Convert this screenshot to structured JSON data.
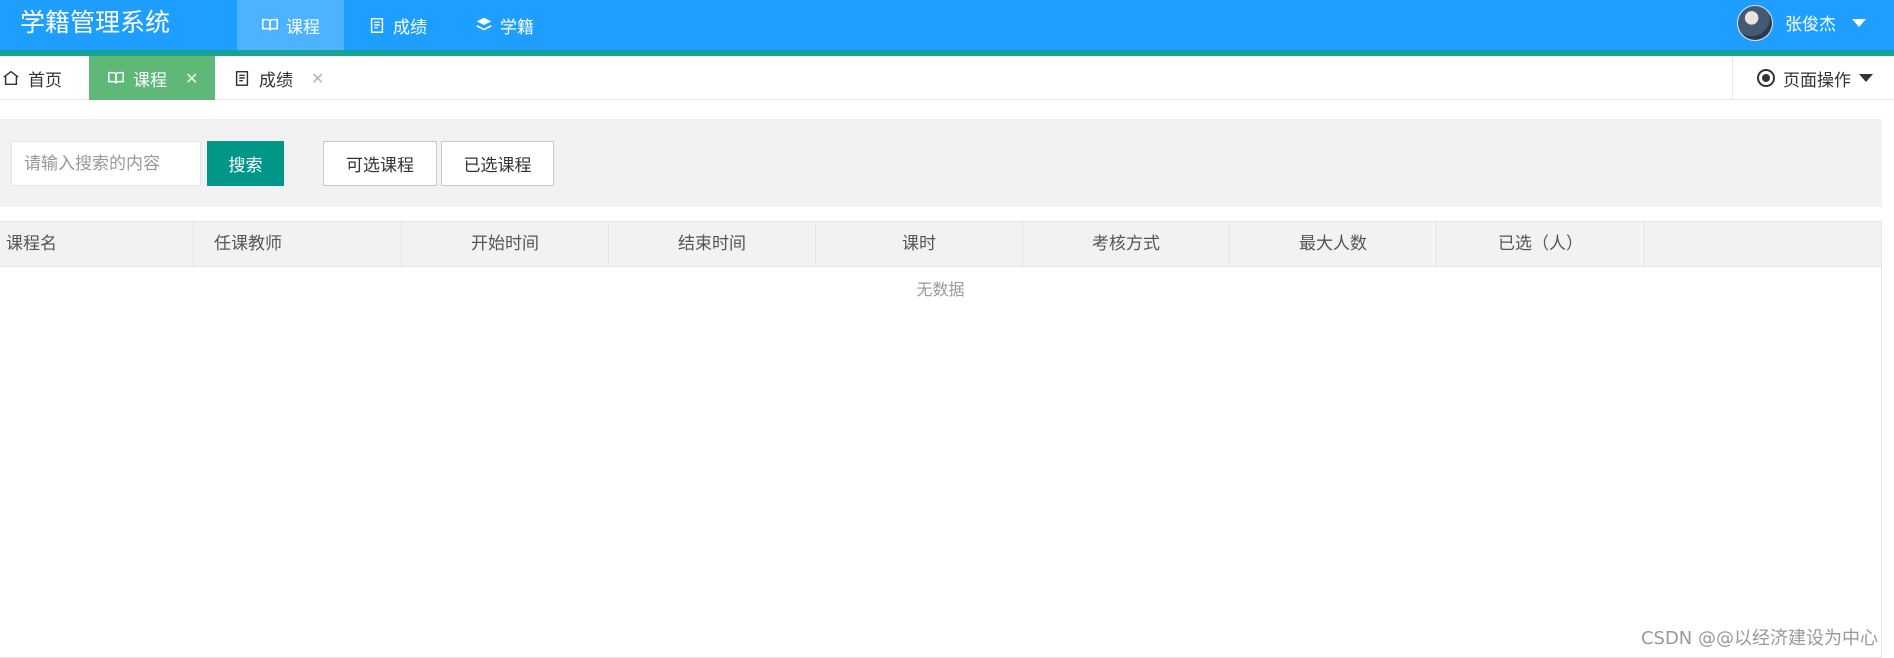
{
  "header": {
    "title": "学籍管理系统",
    "nav": [
      {
        "label": "课程",
        "icon": "book-icon",
        "active": true
      },
      {
        "label": "成绩",
        "icon": "clipboard-icon",
        "active": false
      },
      {
        "label": "学籍",
        "icon": "layers-icon",
        "active": false
      }
    ],
    "user_name": "张俊杰"
  },
  "tabs": {
    "home": "首页",
    "course": "课程",
    "score": "成绩",
    "close_glyph": "✕",
    "page_ops": "页面操作"
  },
  "toolbar": {
    "search_placeholder": "请输入搜索的内容",
    "search_button": "搜索",
    "available_button": "可选课程",
    "selected_button": "已选课程"
  },
  "table": {
    "columns": [
      "课程名",
      "任课教师",
      "开始时间",
      "结束时间",
      "课时",
      "考核方式",
      "最大人数",
      "已选（人）",
      ""
    ],
    "rows": [],
    "empty_text": "无数据"
  },
  "watermark": "CSDN @@以经济建设为中心",
  "colors": {
    "header": "#1E9FFF",
    "active_tab": "#5FB878",
    "primary_button": "#009688"
  }
}
